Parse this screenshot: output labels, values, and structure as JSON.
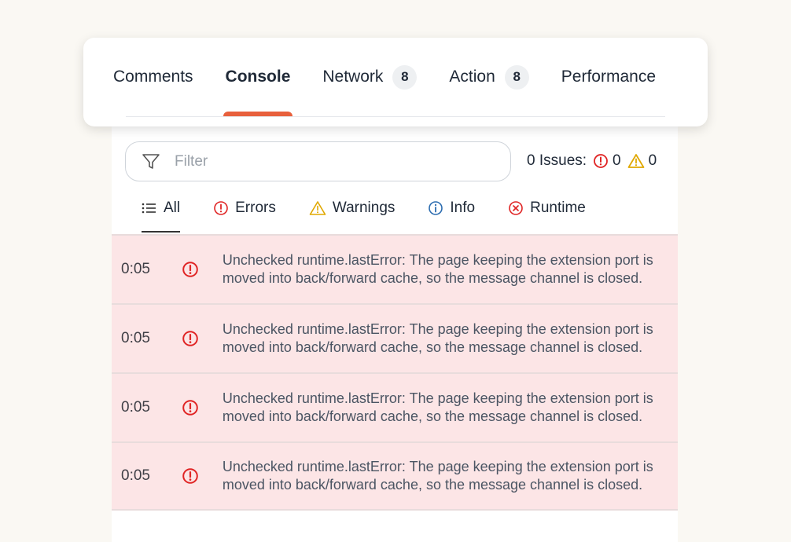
{
  "tabs": [
    {
      "label": "Comments",
      "badge": null,
      "active": false
    },
    {
      "label": "Console",
      "badge": null,
      "active": true
    },
    {
      "label": "Network",
      "badge": "8",
      "active": false
    },
    {
      "label": "Action",
      "badge": "8",
      "active": false
    },
    {
      "label": "Performance",
      "badge": null,
      "active": false
    }
  ],
  "filter": {
    "placeholder": "Filter",
    "value": ""
  },
  "issues": {
    "label": "0 Issues:",
    "error_count": "0",
    "warning_count": "0"
  },
  "subtabs": [
    {
      "label": "All",
      "icon": "list-icon"
    },
    {
      "label": "Errors",
      "icon": "error-icon"
    },
    {
      "label": "Warnings",
      "icon": "warning-icon"
    },
    {
      "label": "Info",
      "icon": "info-icon"
    },
    {
      "label": "Runtime",
      "icon": "runtime-icon"
    }
  ],
  "logs": [
    {
      "time": "0:05",
      "message": "Unchecked runtime.lastError: The page keeping the extension port is moved into back/forward cache, so the message channel is closed."
    },
    {
      "time": "0:05",
      "message": "Unchecked runtime.lastError: The page keeping the extension port is moved into back/forward cache, so the message channel is closed."
    },
    {
      "time": "0:05",
      "message": "Unchecked runtime.lastError: The page keeping the extension port is moved into back/forward cache, so the message channel is closed."
    },
    {
      "time": "0:05",
      "message": "Unchecked runtime.lastError: The page keeping the extension port is moved into back/forward cache, so the message channel is closed."
    }
  ],
  "colors": {
    "accent": "#e8603c",
    "error": "#e02424",
    "warning": "#e0a800",
    "info": "#2b6cb0",
    "row_bg": "#fce5e6"
  }
}
